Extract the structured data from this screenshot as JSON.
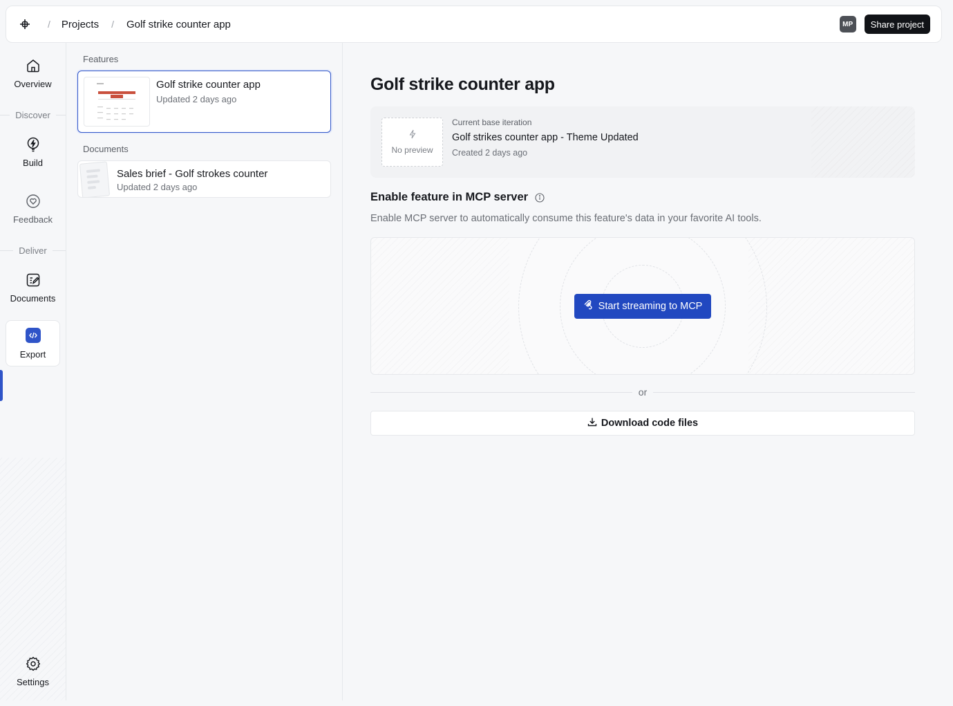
{
  "header": {
    "logo_icon": "hash-node-icon",
    "separator": "/",
    "breadcrumbs": [
      "Projects",
      "Golf strike counter app"
    ],
    "avatar_initials": "MP",
    "share_label": "Share project"
  },
  "rail": {
    "items": [
      {
        "label": "Overview",
        "icon": "home-icon"
      },
      {
        "label": "Build",
        "icon": "lightning-icon"
      },
      {
        "label": "Feedback",
        "icon": "heart-chat-icon"
      },
      {
        "label": "Documents",
        "icon": "document-edit-icon"
      },
      {
        "label": "Export",
        "icon": "code-icon",
        "active": true
      },
      {
        "label": "Settings",
        "icon": "gear-icon"
      }
    ],
    "sections": [
      "Discover",
      "Deliver"
    ],
    "accent_color": "#2f54c8"
  },
  "list": {
    "features_label": "Features",
    "feature": {
      "title": "Golf strike counter app",
      "updated": "Updated 2 days ago"
    },
    "documents_label": "Documents",
    "document": {
      "title": "Sales brief - Golf strokes counter",
      "updated": "Updated 2 days ago"
    }
  },
  "main": {
    "title": "Golf strike counter app",
    "iteration": {
      "preview_text": "No preview",
      "label": "Current base iteration",
      "name": "Golf strikes counter app - Theme Updated",
      "created": "Created 2 days ago"
    },
    "mcp": {
      "title": "Enable feature in MCP server",
      "description": "Enable MCP server to automatically consume this feature's data in your favorite AI tools.",
      "button_label": "Start streaming to MCP",
      "button_color": "#2148c0"
    },
    "or_label": "or",
    "download_label": "Download code files"
  }
}
